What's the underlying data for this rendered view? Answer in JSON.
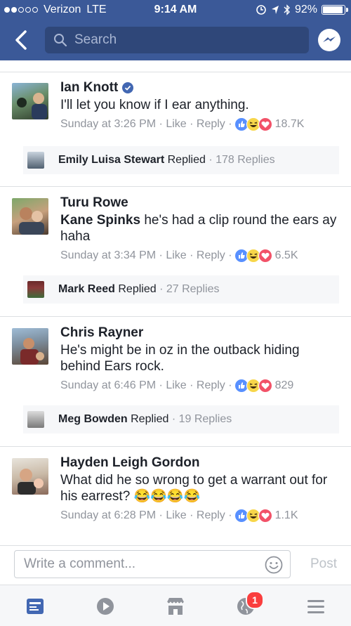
{
  "status_bar": {
    "carrier": "Verizon",
    "network": "LTE",
    "time": "9:14 AM",
    "battery": "92%"
  },
  "search": {
    "placeholder": "Search"
  },
  "comments": [
    {
      "author": "Ian Knott",
      "verified": true,
      "mention": "",
      "text": "I'll let you know if I ear anything.",
      "time": "Sunday at 3:26 PM",
      "like": "Like",
      "reply": "Reply",
      "reactions_count": "18.7K",
      "replied_by": "Emily Luisa Stewart",
      "replied_word": "Replied",
      "replies": "178 Replies"
    },
    {
      "author": "Turu Rowe",
      "verified": false,
      "mention": "Kane Spinks",
      "text": "he's had a clip round the ears ay haha",
      "time": "Sunday at 3:34 PM",
      "like": "Like",
      "reply": "Reply",
      "reactions_count": "6.5K",
      "replied_by": "Mark Reed",
      "replied_word": "Replied",
      "replies": "27 Replies"
    },
    {
      "author": "Chris Rayner",
      "verified": false,
      "mention": "",
      "text": "He's might be in oz in the outback hiding behind Ears rock.",
      "time": "Sunday at 6:46 PM",
      "like": "Like",
      "reply": "Reply",
      "reactions_count": "829",
      "replied_by": "Meg Bowden",
      "replied_word": "Replied",
      "replies": "19 Replies"
    },
    {
      "author": "Hayden Leigh Gordon",
      "verified": false,
      "mention": "",
      "text": "What did he so wrong to get a warrant out for his earrest? 😂😂😂😂",
      "time": "Sunday at 6:28 PM",
      "like": "Like",
      "reply": "Reply",
      "reactions_count": "1.1K"
    }
  ],
  "composer": {
    "placeholder": "Write a comment...",
    "post_label": "Post"
  },
  "tabbar": {
    "notifications_badge": "1"
  },
  "colors": {
    "brand": "#3b5998",
    "like_blue": "#5890ff",
    "haha_yellow": "#f7d64a",
    "love_red": "#f25268"
  }
}
